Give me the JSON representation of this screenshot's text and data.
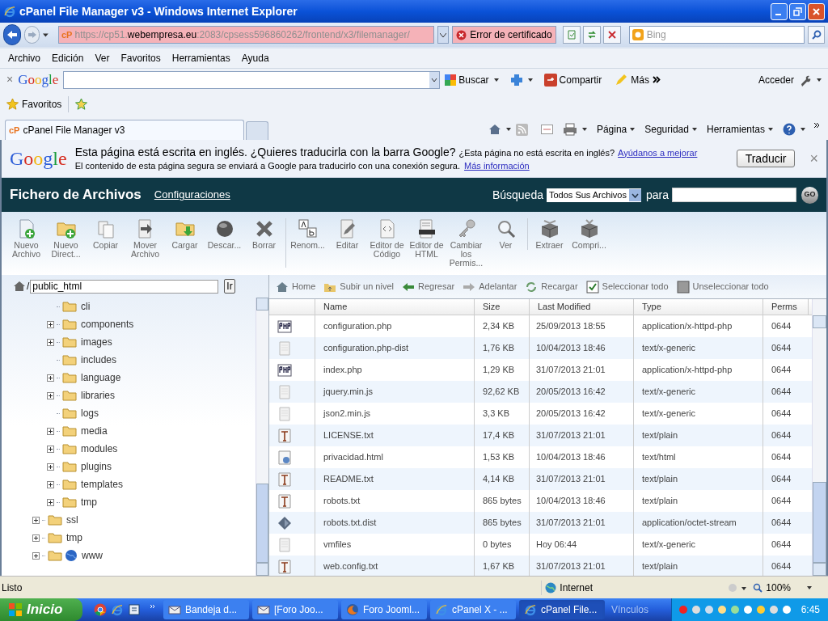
{
  "window": {
    "title": "cPanel File Manager v3 - Windows Internet Explorer"
  },
  "address_bar": {
    "site_icon": "cP",
    "url_prefix": "https://cp51.",
    "url_domain": "webempresa.eu",
    "url_suffix": ":2083/cpsess596860262/frontend/x3/filemanager/",
    "certificate_error": "Error de certificado",
    "search_placeholder": "Bing"
  },
  "menu": [
    "Archivo",
    "Edición",
    "Ver",
    "Favoritos",
    "Herramientas",
    "Ayuda"
  ],
  "google_toolbar": {
    "close": "×",
    "logo": "Google",
    "search": "Buscar",
    "share": "Compartir",
    "more": "Más",
    "sign_in": "Acceder"
  },
  "favorites_bar": {
    "label": "Favoritos"
  },
  "tabs": [
    {
      "site_icon": "cP",
      "title": "cPanel File Manager v3",
      "selected": true
    }
  ],
  "command_bar": [
    "Página",
    "Seguridad",
    "Herramientas"
  ],
  "translate_bar": {
    "logo": "Google",
    "message": "Esta página está escrita en inglés. ¿Quieres traducirla con la barra Google?",
    "question": "¿Esta página no está escrita en inglés?",
    "help_link": "Ayúdanos a mejorar",
    "notice": "El contenido de esta página segura se enviará a Google para traducirlo con una conexión segura.",
    "info_link": "Más información",
    "button": "Traducir",
    "close": "×"
  },
  "header": {
    "title": "Fichero de Archivos",
    "settings_link": "Configuraciones",
    "search_label": "Búsqueda",
    "search_scope": "Todos Sus Archivos",
    "for_label": "para",
    "go": "GO"
  },
  "toolbar": [
    {
      "items": [
        {
          "kind": "new-file",
          "label": "Nuevo Archivo"
        },
        {
          "kind": "new-folder",
          "label": "Nuevo Direct..."
        },
        {
          "kind": "copy",
          "label": "Copiar"
        },
        {
          "kind": "move",
          "label": "Mover Archivo"
        },
        {
          "kind": "upload",
          "label": "Cargar"
        },
        {
          "kind": "download",
          "label": "Descar..."
        },
        {
          "kind": "delete",
          "label": "Borrar"
        }
      ]
    },
    {
      "items": [
        {
          "kind": "rename",
          "label": "Renom..."
        },
        {
          "kind": "edit",
          "label": "Editar"
        },
        {
          "kind": "code",
          "label": "Editor de Código"
        },
        {
          "kind": "html",
          "label": "Editor de HTML"
        },
        {
          "kind": "permissions",
          "label": "Cambiar los Permis..."
        },
        {
          "kind": "view",
          "label": "Ver"
        }
      ]
    },
    {
      "items": [
        {
          "kind": "extract",
          "label": "Extraer"
        },
        {
          "kind": "compress",
          "label": "Compri..."
        }
      ]
    }
  ],
  "path": {
    "separator": "/",
    "value": "public_html",
    "button": "Ir"
  },
  "tree": [
    {
      "children": [
        {
          "label": "cli",
          "expandable": false
        },
        {
          "label": "components",
          "expandable": true
        },
        {
          "label": "images",
          "expandable": true
        },
        {
          "label": "includes",
          "expandable": false
        },
        {
          "label": "language",
          "expandable": true
        },
        {
          "label": "libraries",
          "expandable": true
        },
        {
          "label": "logs",
          "expandable": false
        },
        {
          "label": "media",
          "expandable": true
        },
        {
          "label": "modules",
          "expandable": true
        },
        {
          "label": "plugins",
          "expandable": true
        },
        {
          "label": "templates",
          "expandable": true
        },
        {
          "label": "tmp",
          "expandable": true
        }
      ]
    },
    {
      "label": "ssl",
      "expandable": true,
      "kind": "folder"
    },
    {
      "label": "tmp",
      "expandable": true,
      "kind": "folder"
    },
    {
      "label": "www",
      "expandable": true,
      "kind": "web"
    }
  ],
  "nav_bar": [
    {
      "kind": "home",
      "label": "Home"
    },
    {
      "kind": "up",
      "label": "Subir un nivel"
    },
    {
      "kind": "back",
      "label": "Regresar"
    },
    {
      "kind": "forward",
      "label": "Adelantar"
    },
    {
      "kind": "reload",
      "label": "Recargar"
    },
    {
      "kind": "select-all",
      "label": "Seleccionar todo"
    },
    {
      "kind": "unselect-all",
      "label": "Unseleccionar todo"
    }
  ],
  "table": {
    "columns": [
      "Name",
      "Size",
      "Last Modified",
      "Type",
      "Perms"
    ],
    "rows": [
      {
        "kind": "php",
        "name": "configuration.php",
        "size": "2,34 KB",
        "modified": "25/09/2013 18:55",
        "type": "application/x-httpd-php",
        "perms": "0644"
      },
      {
        "kind": "generic",
        "name": "configuration.php-dist",
        "size": "1,76 KB",
        "modified": "10/04/2013 18:46",
        "type": "text/x-generic",
        "perms": "0644"
      },
      {
        "kind": "php",
        "name": "index.php",
        "size": "1,29 KB",
        "modified": "31/07/2013 21:01",
        "type": "application/x-httpd-php",
        "perms": "0644"
      },
      {
        "kind": "generic",
        "name": "jquery.min.js",
        "size": "92,62 KB",
        "modified": "20/05/2013 16:42",
        "type": "text/x-generic",
        "perms": "0644"
      },
      {
        "kind": "generic",
        "name": "json2.min.js",
        "size": "3,3 KB",
        "modified": "20/05/2013 16:42",
        "type": "text/x-generic",
        "perms": "0644"
      },
      {
        "kind": "text",
        "name": "LICENSE.txt",
        "size": "17,4 KB",
        "modified": "31/07/2013 21:01",
        "type": "text/plain",
        "perms": "0644"
      },
      {
        "kind": "html",
        "name": "privacidad.html",
        "size": "1,53 KB",
        "modified": "10/04/2013 18:46",
        "type": "text/html",
        "perms": "0644"
      },
      {
        "kind": "text",
        "name": "README.txt",
        "size": "4,14 KB",
        "modified": "31/07/2013 21:01",
        "type": "text/plain",
        "perms": "0644"
      },
      {
        "kind": "text",
        "name": "robots.txt",
        "size": "865 bytes",
        "modified": "10/04/2013 18:46",
        "type": "text/plain",
        "perms": "0644"
      },
      {
        "kind": "binary",
        "name": "robots.txt.dist",
        "size": "865 bytes",
        "modified": "31/07/2013 21:01",
        "type": "application/octet-stream",
        "perms": "0644"
      },
      {
        "kind": "generic",
        "name": "vmfiles",
        "size": "0 bytes",
        "modified": "Hoy 06:44",
        "type": "text/x-generic",
        "perms": "0644"
      },
      {
        "kind": "text",
        "name": "web.config.txt",
        "size": "1,67 KB",
        "modified": "31/07/2013 21:01",
        "type": "text/plain",
        "perms": "0644"
      }
    ]
  },
  "status_bar": {
    "text": "Listo",
    "zone": "Internet",
    "zoom": "100%"
  },
  "taskbar": {
    "start": "Inicio",
    "tasks": [
      {
        "kind": "mail",
        "label": "Bandeja d...",
        "selected": false
      },
      {
        "kind": "mail",
        "label": "[Foro Joo...",
        "selected": false
      },
      {
        "kind": "firefox",
        "label": "Foro Jooml...",
        "selected": false
      },
      {
        "kind": "ie",
        "label": "cPanel X - ...",
        "selected": false
      },
      {
        "kind": "ie",
        "label": "cPanel File...",
        "selected": true
      }
    ],
    "links": "Vínculos",
    "clock": "6:45"
  }
}
